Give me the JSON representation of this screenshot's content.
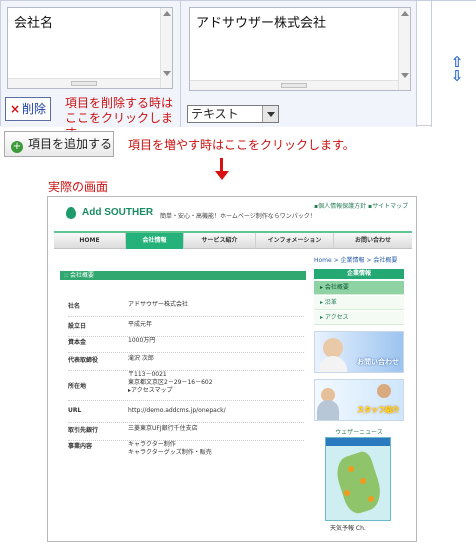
{
  "editor": {
    "field_label_value": "会社名",
    "field_content_value": "アドサウザー株式会社",
    "delete_button": "削除",
    "delete_icon": "x-icon",
    "delete_note": [
      "項目を削除する時は",
      "ここをクリックします。"
    ],
    "type_select_value": "テキスト",
    "reorder_icons": "up-down-arrows-icon"
  },
  "add": {
    "button_label": "項目を追加する",
    "note": "項目を増やす時はここをクリックします。"
  },
  "preview_caption": "実際の画面",
  "site": {
    "logo": "Add SOUTHER",
    "tagline": "簡単・安心・高機能！ホームページ制作ならワンパック！",
    "top_links": [
      "個人情報保護方針",
      "サイトマップ"
    ],
    "nav": [
      "HOME",
      "会社情報",
      "サービス紹介",
      "インフォメーション",
      "お問い合わせ"
    ],
    "nav_active": 1,
    "breadcrumb": "Home > 企業情報 > 会社概要",
    "section_title": "会社概要",
    "rows": [
      {
        "k": "社名",
        "v": "アドサウザー株式会社"
      },
      {
        "k": "設立日",
        "v": "平成元年"
      },
      {
        "k": "資本金",
        "v": "1000万円"
      },
      {
        "k": "代表取締役",
        "v": "滝沢 次郎"
      },
      {
        "k": "所在地",
        "v": "〒113－0021\n東京都文京区2－29－16－602\n▸アクセスマップ"
      },
      {
        "k": "URL",
        "v": "http://demo.addcms.jp/onepack/"
      },
      {
        "k": "取引先銀行",
        "v": "三菱東京UFJ銀行千住支店"
      },
      {
        "k": "事業内容",
        "v": "キャラクター制作\nキャラクターグッズ制作・販売"
      }
    ],
    "side_title": "企業情報",
    "side_items": [
      "会社概要",
      "沿革",
      "アクセス"
    ],
    "banner1": "お問い合わせ",
    "banner2": "スタッフ紹介",
    "weather_title": "ウェザーニュース",
    "weather_caption": "天気予報 Ch."
  },
  "colors": {
    "accent_green": "#24b27a",
    "note_red": "#cc1111",
    "link_blue": "#1b3ea8"
  }
}
